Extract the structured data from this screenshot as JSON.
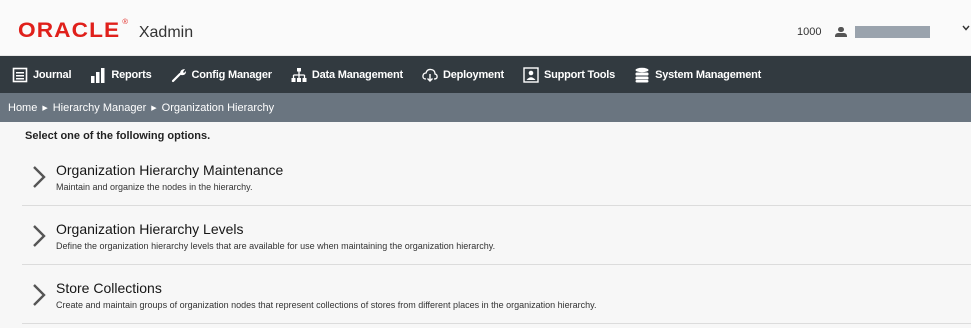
{
  "header": {
    "logo_text": "ORACLE",
    "logo_mark": "®",
    "app_name": "Xadmin",
    "store_number": "1000",
    "user_icon": "user-icon"
  },
  "nav": {
    "items": [
      {
        "label": "Journal",
        "icon": "journal-icon"
      },
      {
        "label": "Reports",
        "icon": "reports-icon"
      },
      {
        "label": "Config Manager",
        "icon": "wrench-icon"
      },
      {
        "label": "Data Management",
        "icon": "hierarchy-icon"
      },
      {
        "label": "Deployment",
        "icon": "cloud-download-icon"
      },
      {
        "label": "Support Tools",
        "icon": "support-icon"
      },
      {
        "label": "System Management",
        "icon": "database-icon"
      }
    ]
  },
  "breadcrumb": {
    "items": [
      "Home",
      "Hierarchy Manager",
      "Organization Hierarchy"
    ]
  },
  "main": {
    "instruction": "Select one of the following options.",
    "options": [
      {
        "title": "Organization Hierarchy Maintenance",
        "description": "Maintain and organize the nodes in the hierarchy."
      },
      {
        "title": "Organization Hierarchy Levels",
        "description": "Define the organization hierarchy levels that are available for use when maintaining the organization hierarchy."
      },
      {
        "title": "Store Collections",
        "description": "Create and maintain groups of organization nodes that represent collections of stores from different places in the organization hierarchy."
      }
    ]
  },
  "colors": {
    "brand_red": "#e0201b",
    "nav_bg": "#323a40",
    "breadcrumb_bg": "#6a7580",
    "content_bg": "#f7f7f7"
  }
}
